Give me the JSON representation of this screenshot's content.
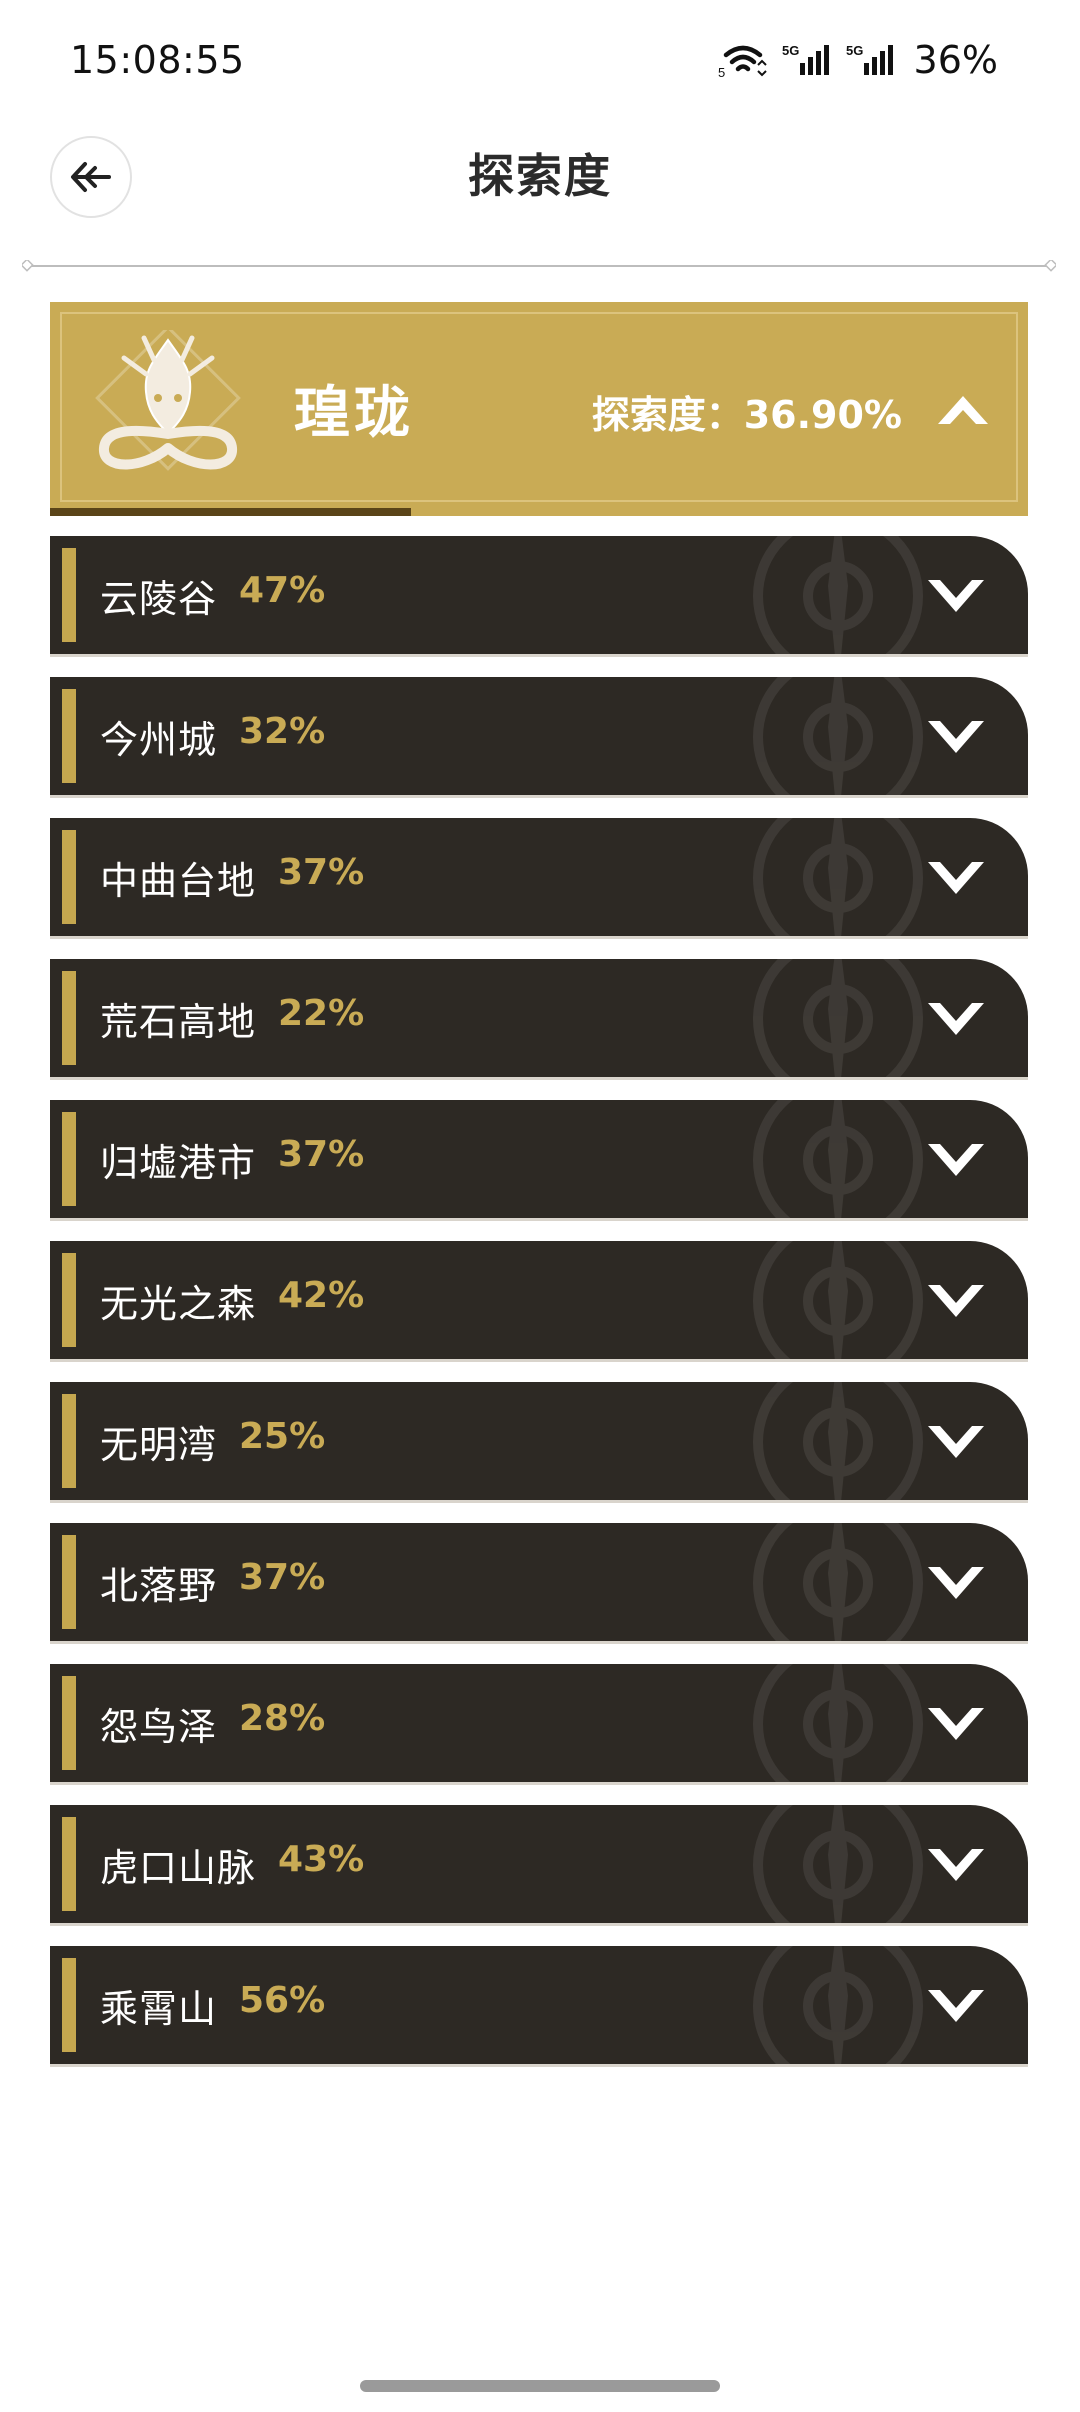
{
  "status_bar": {
    "time": "15:08:55",
    "battery": "36%",
    "sim1": "5G",
    "sim2": "5G",
    "wifi_label": "5"
  },
  "header": {
    "title": "探索度"
  },
  "region": {
    "name": "瑝珑",
    "progress_label": "探索度：36.90%",
    "progress_value": 0.369
  },
  "areas": [
    {
      "name": "云陵谷",
      "pct": "47%"
    },
    {
      "name": "今州城",
      "pct": "32%"
    },
    {
      "name": "中曲台地",
      "pct": "37%"
    },
    {
      "name": "荒石高地",
      "pct": "22%"
    },
    {
      "name": "归墟港市",
      "pct": "37%"
    },
    {
      "name": "无光之森",
      "pct": "42%"
    },
    {
      "name": "无明湾",
      "pct": "25%"
    },
    {
      "name": "北落野",
      "pct": "37%"
    },
    {
      "name": "怨鸟泽",
      "pct": "28%"
    },
    {
      "name": "虎口山脉",
      "pct": "43%"
    },
    {
      "name": "乘霄山",
      "pct": "56%"
    }
  ],
  "colors": {
    "gold": "#c9ab55",
    "row_bg": "#2d2924",
    "accent": "#c5a74f"
  },
  "icons": {
    "back": "back-arrow-icon",
    "collapse": "chevron-up-icon",
    "expand": "chevron-down-icon",
    "emblem": "dragon-emblem-icon"
  }
}
